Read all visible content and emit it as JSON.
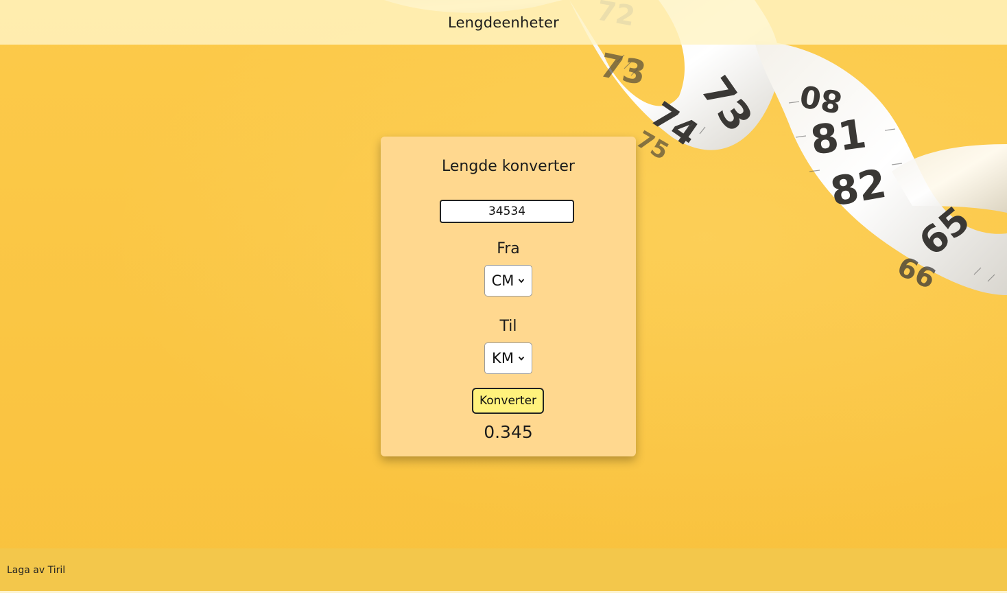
{
  "header": {
    "title": "Lengdeenheter"
  },
  "converter": {
    "title": "Lengde konverter",
    "input_value": "34534",
    "from_label": "Fra",
    "from_unit": "CM",
    "to_label": "Til",
    "to_unit": "KM",
    "button_label": "Konverter",
    "result": "0.345"
  },
  "footer": {
    "text": "Laga av Tiril"
  },
  "background_tape_numbers": [
    "72",
    "73",
    "73",
    "74",
    "75",
    "80",
    "81",
    "82",
    "65",
    "66"
  ],
  "icons": [
    "chevron-down-icon"
  ],
  "colors": {
    "page_background": "#fbc944",
    "card_background": "#ffd88f",
    "button_background": "#fff27c",
    "header_background": "#fff4c4"
  }
}
